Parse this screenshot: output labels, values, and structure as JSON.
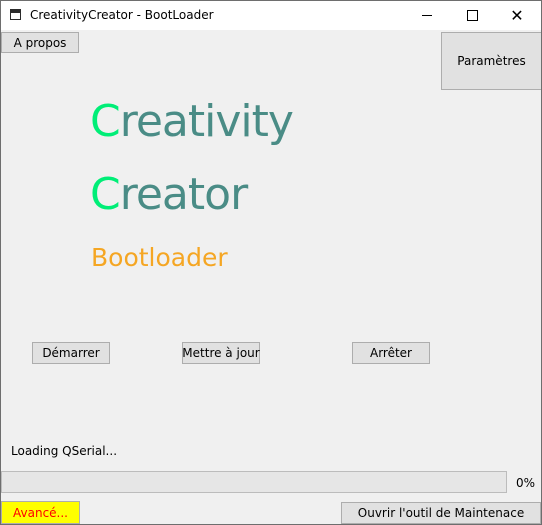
{
  "window": {
    "title": "CreativityCreator - BootLoader",
    "controls": {
      "minimize": "—",
      "maximize": "☐",
      "close": "✕"
    }
  },
  "toolbar": {
    "about_label": "A propos",
    "settings_label": "Paramètres"
  },
  "logo": {
    "line1_initial": "C",
    "line1_rest": "reativity",
    "line2_initial": "C",
    "line2_rest": "reator",
    "subtitle": "Bootloader",
    "colors": {
      "initial": "#00ee77",
      "text": "#4a8c86",
      "subtitle": "#f5a623"
    }
  },
  "actions": {
    "start_label": "Démarrer",
    "update_label": "Mettre à jour",
    "stop_label": "Arrêter"
  },
  "status": {
    "text": "Loading QSerial...",
    "progress_value": 0,
    "progress_label": "0%"
  },
  "footer": {
    "advanced_label": "Avancé...",
    "maintenance_label": "Ouvrir l'outil de Maintenace",
    "advanced_colors": {
      "background": "#ffff00",
      "text": "#ff0000"
    }
  }
}
